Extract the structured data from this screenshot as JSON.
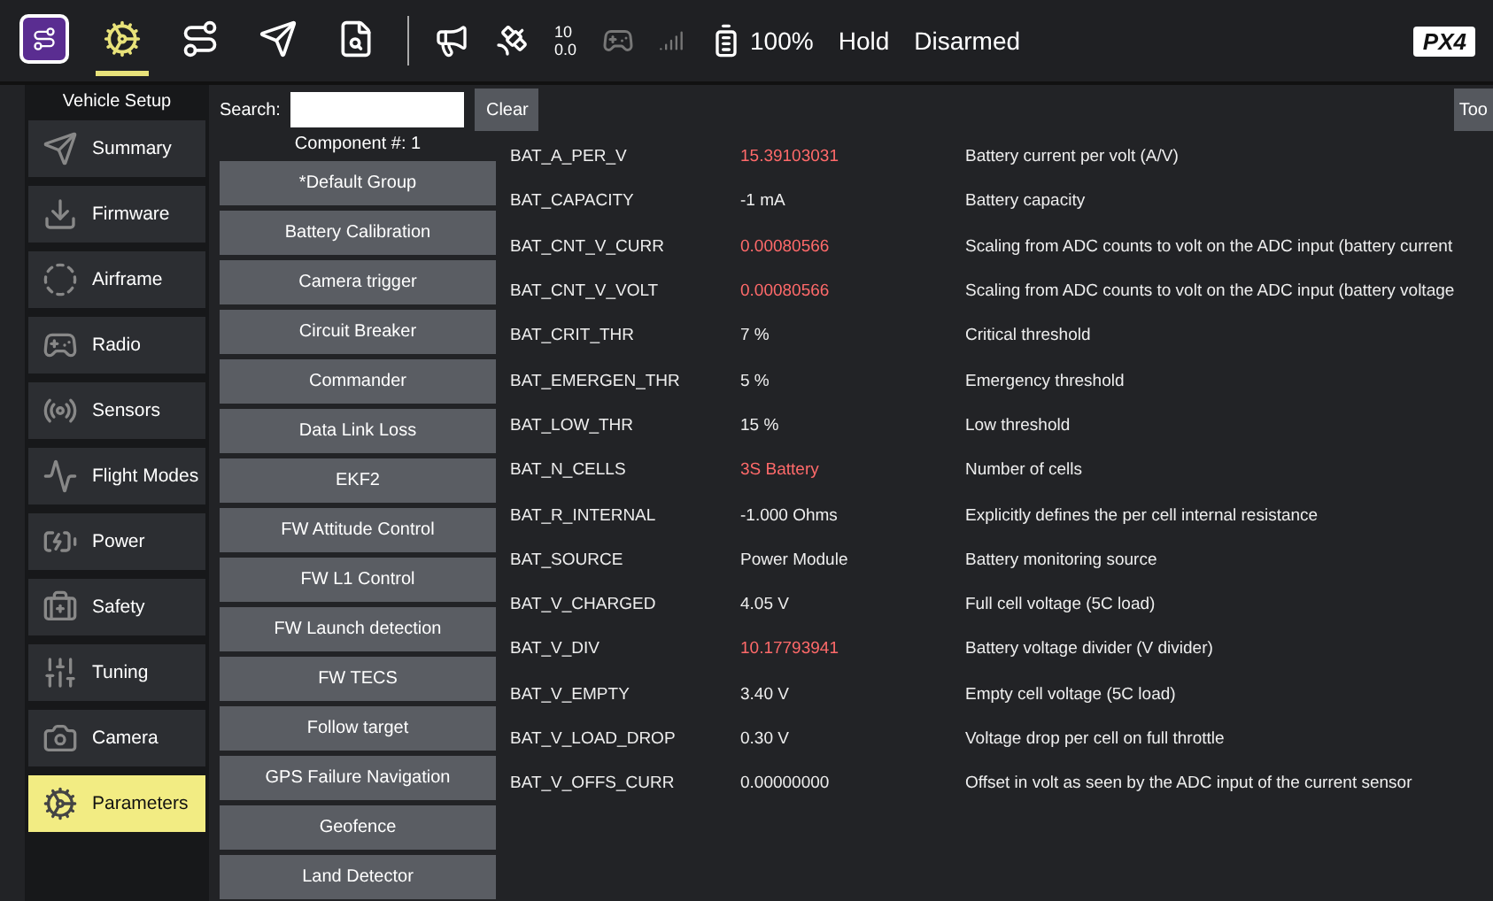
{
  "toolbar": {
    "tools": [
      {
        "selected": false
      },
      {
        "selected": true
      },
      {
        "selected": false
      },
      {
        "selected": false
      },
      {
        "selected": false
      }
    ],
    "satellites": {
      "count": "10",
      "hdop": "0.0"
    },
    "battery": "100%",
    "mode": "Hold",
    "arm_state": "Disarmed",
    "logo": "PX4"
  },
  "sidebar": {
    "title": "Vehicle Setup",
    "items": [
      {
        "label": "Summary",
        "selected": false
      },
      {
        "label": "Firmware",
        "selected": false
      },
      {
        "label": "Airframe",
        "selected": false
      },
      {
        "label": "Radio",
        "selected": false
      },
      {
        "label": "Sensors",
        "selected": false
      },
      {
        "label": "Flight Modes",
        "selected": false
      },
      {
        "label": "Power",
        "selected": false
      },
      {
        "label": "Safety",
        "selected": false
      },
      {
        "label": "Tuning",
        "selected": false
      },
      {
        "label": "Camera",
        "selected": false
      },
      {
        "label": "Parameters",
        "selected": true
      }
    ]
  },
  "search": {
    "label": "Search:",
    "clear": "Clear",
    "tools": "Too"
  },
  "groups": {
    "component": "Component #: 1",
    "items": [
      "*Default Group",
      "Battery Calibration",
      "Camera trigger",
      "Circuit Breaker",
      "Commander",
      "Data Link Loss",
      "EKF2",
      "FW Attitude Control",
      "FW L1 Control",
      "FW Launch detection",
      "FW TECS",
      "Follow target",
      "GPS Failure Navigation",
      "Geofence",
      "Land Detector"
    ]
  },
  "params": [
    {
      "name": "BAT_A_PER_V",
      "value": "15.39103031",
      "modified": true,
      "description": "Battery current per volt (A/V)"
    },
    {
      "name": "BAT_CAPACITY",
      "value": "-1 mA",
      "modified": false,
      "description": "Battery capacity"
    },
    {
      "name": "BAT_CNT_V_CURR",
      "value": "0.00080566",
      "modified": true,
      "description": "Scaling from ADC counts to volt on the ADC input (battery current"
    },
    {
      "name": "BAT_CNT_V_VOLT",
      "value": "0.00080566",
      "modified": true,
      "description": "Scaling from ADC counts to volt on the ADC input (battery voltage"
    },
    {
      "name": "BAT_CRIT_THR",
      "value": "7 %",
      "modified": false,
      "description": "Critical threshold"
    },
    {
      "name": "BAT_EMERGEN_THR",
      "value": "5 %",
      "modified": false,
      "description": "Emergency threshold"
    },
    {
      "name": "BAT_LOW_THR",
      "value": "15 %",
      "modified": false,
      "description": "Low threshold"
    },
    {
      "name": "BAT_N_CELLS",
      "value": "3S Battery",
      "modified": true,
      "description": "Number of cells"
    },
    {
      "name": "BAT_R_INTERNAL",
      "value": "-1.000 Ohms",
      "modified": false,
      "description": "Explicitly defines the per cell internal resistance"
    },
    {
      "name": "BAT_SOURCE",
      "value": "Power Module",
      "modified": false,
      "description": "Battery monitoring source"
    },
    {
      "name": "BAT_V_CHARGED",
      "value": "4.05 V",
      "modified": false,
      "description": "Full cell voltage (5C load)"
    },
    {
      "name": "BAT_V_DIV",
      "value": "10.17793941",
      "modified": true,
      "description": "Battery voltage divider (V divider)"
    },
    {
      "name": "BAT_V_EMPTY",
      "value": "3.40 V",
      "modified": false,
      "description": "Empty cell voltage (5C load)"
    },
    {
      "name": "BAT_V_LOAD_DROP",
      "value": "0.30 V",
      "modified": false,
      "description": "Voltage drop per cell on full throttle"
    },
    {
      "name": "BAT_V_OFFS_CURR",
      "value": "0.00000000",
      "modified": false,
      "description": "Offset in volt as seen by the ADC input of the current sensor"
    }
  ]
}
